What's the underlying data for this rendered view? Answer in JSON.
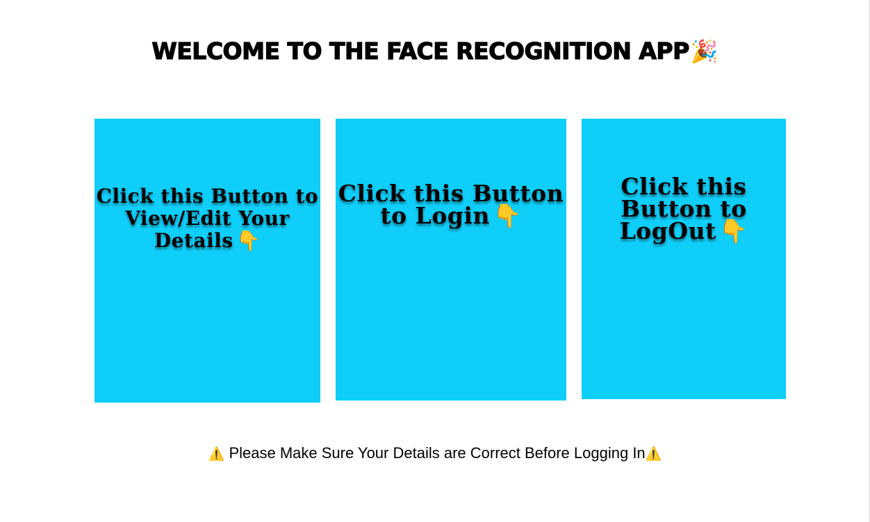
{
  "header": {
    "title": "WELCOME TO THE FACE RECOGNITION APP",
    "title_icon": "party-popper-icon",
    "title_icon_glyph": "🎉"
  },
  "cards": [
    {
      "label": "Click this Button to View/Edit Your Details",
      "icon": "point-down-icon",
      "icon_glyph": "👇"
    },
    {
      "label": "Click this Button to Login",
      "icon": "point-down-icon",
      "icon_glyph": "👇"
    },
    {
      "label": "Click this Button to LogOut",
      "icon": "point-down-icon",
      "icon_glyph": "👇"
    }
  ],
  "notice": {
    "text": "Please Make Sure Your Details are Correct Before Logging In",
    "icon": "warning-icon",
    "icon_glyph": "⚠️"
  },
  "colors": {
    "card_background": "#0fcef9",
    "page_background": "#ffffff",
    "text": "#000000"
  }
}
